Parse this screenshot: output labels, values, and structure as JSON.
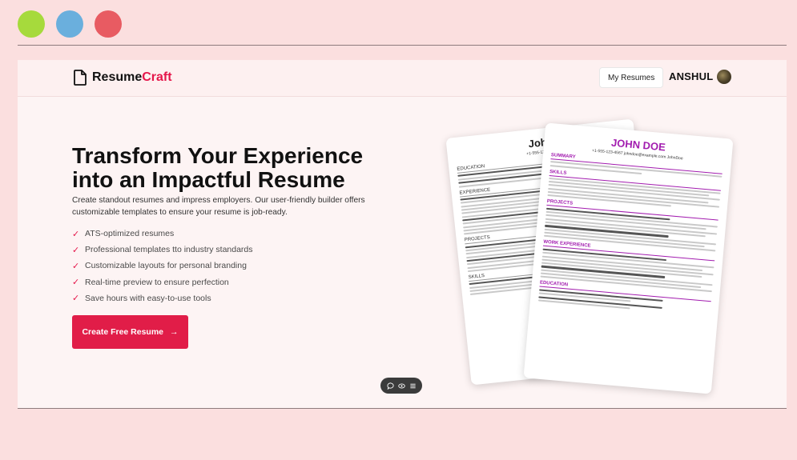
{
  "window_controls": {
    "colors": [
      "#a6da3c",
      "#6aafdd",
      "#e85b62"
    ]
  },
  "app": {
    "brand": {
      "name_main": "Resume",
      "name_accent": "Craft"
    },
    "nav": {
      "my_resumes": "My Resumes",
      "username": "ANSHUL"
    },
    "hero": {
      "title_line1": "Transform Your Experience",
      "title_line2": "into an Impactful Resume",
      "subtitle": "Create standout resumes and impress employers. Our user-friendly builder offers customizable templates to ensure your resume is job-ready.",
      "features": [
        "ATS-optimized resumes",
        "Professional templates tto industry standards",
        "Customizable layouts for personal branding",
        "Real-time preview to ensure perfection",
        "Save hours with easy-to-use tools"
      ],
      "cta_label": "Create Free Resume",
      "cta_arrow": "→"
    },
    "preview": {
      "back": {
        "name": "John",
        "contact": "+1-555-123-4567",
        "sections": [
          "EDUCATION",
          "EXPERIENCE",
          "PROJECTS",
          "SKILLS"
        ]
      },
      "front": {
        "name": "JOHN DOE",
        "contact": "+1-555-123-4567   johndoe@example.com   JohnDoe",
        "sections": [
          "SUMMARY",
          "SKILLS",
          "PROJECTS",
          "WORK EXPERIENCE",
          "EDUCATION"
        ]
      }
    },
    "toolbar_icons": [
      "chat-icon",
      "eye-icon",
      "menu-icon"
    ]
  },
  "colors": {
    "accent": "#e5164a",
    "resume_accent": "#a21caf"
  }
}
